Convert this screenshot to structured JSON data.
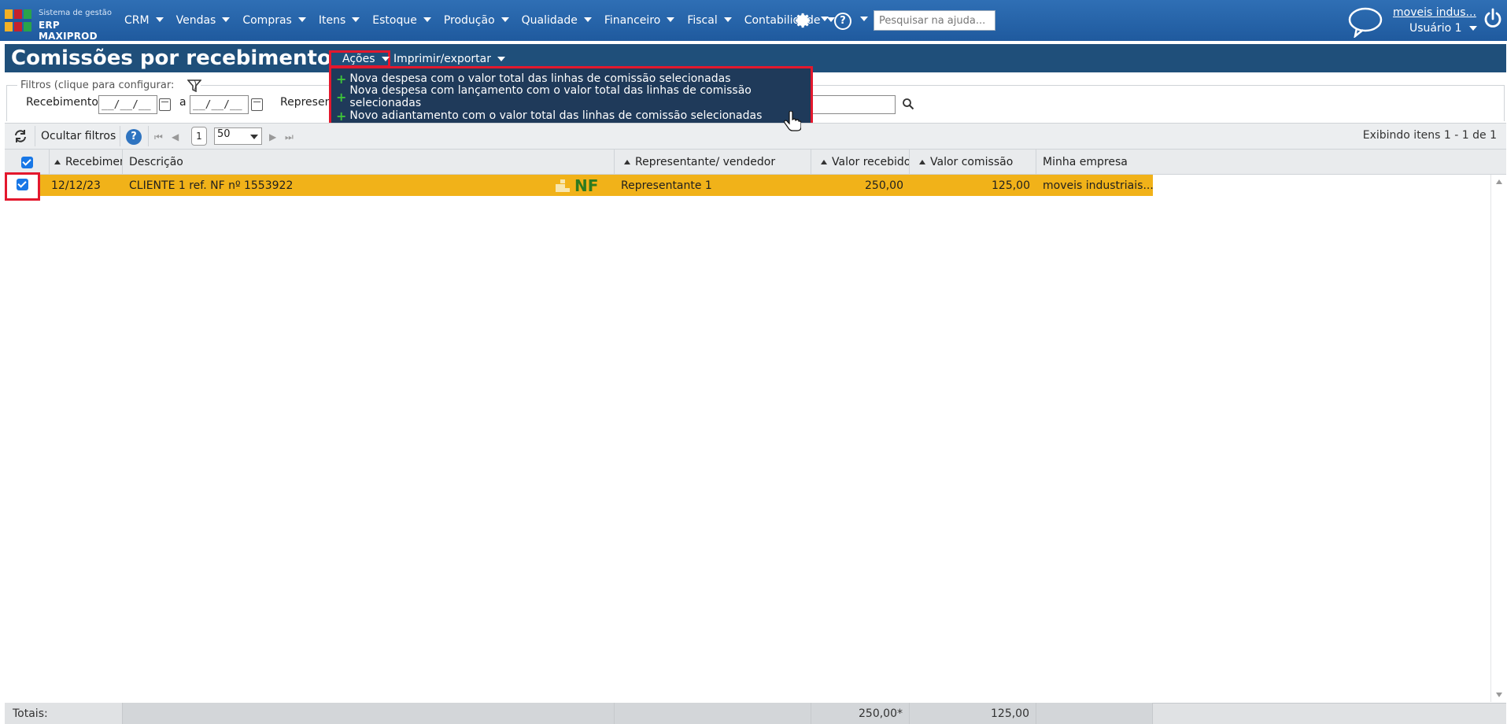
{
  "app": {
    "logo_line1": "Sistema de gestão",
    "logo_line2": "ERP MAXIPROD",
    "menu": [
      "CRM",
      "Vendas",
      "Compras",
      "Itens",
      "Estoque",
      "Produção",
      "Qualidade",
      "Financeiro",
      "Fiscal",
      "Contabilidade"
    ],
    "help_search_placeholder": "Pesquisar na ajuda...",
    "company": "moveis indus...",
    "user": "Usuário 1"
  },
  "page": {
    "title": "Comissões por recebimento",
    "acoes_label": "Ações",
    "print_label": "Imprimir/exportar"
  },
  "acoes_menu": [
    "Nova despesa com o valor total das linhas de comissão selecionadas",
    "Nova despesa com lançamento com o valor total das linhas de comissão selecionadas",
    "Novo adiantamento com o valor total das linhas de comissão selecionadas"
  ],
  "filters": {
    "legend": "Filtros (clique para configurar:",
    "legend_close": ")",
    "recebimento_label": "Recebimento",
    "date_from": "__/__/__",
    "date_to": "__/__/__",
    "between_label": "a",
    "rep_label": "Represent"
  },
  "toolbar": {
    "hide_filters": "Ocultar filtros",
    "help": "?",
    "page": "1",
    "per_page": "50",
    "showing": "Exibindo itens 1 - 1 de 1"
  },
  "grid": {
    "columns": [
      "Recebimen",
      "Descrição",
      "Representante/ vendedor",
      "Valor recebido",
      "Valor comissão",
      "Minha empresa"
    ],
    "rows": [
      {
        "recebimento": "12/12/23",
        "descricao": "CLIENTE 1 ref. NF nº 1553922",
        "nf_badge": "NF",
        "representante": "Representante 1",
        "valor_recebido": "250,00",
        "valor_comissao": "125,00",
        "empresa": "moveis industriais..."
      }
    ]
  },
  "totals": {
    "label": "Totais:",
    "valor_recebido": "250,00*",
    "valor_comissao": "125,00"
  },
  "colors": {
    "nav": "#2f6fb5",
    "titlebar": "#1f4f7a",
    "dropdown": "#1f3a5a",
    "highlight": "#e3182d",
    "row_selected": "#f1b219"
  }
}
